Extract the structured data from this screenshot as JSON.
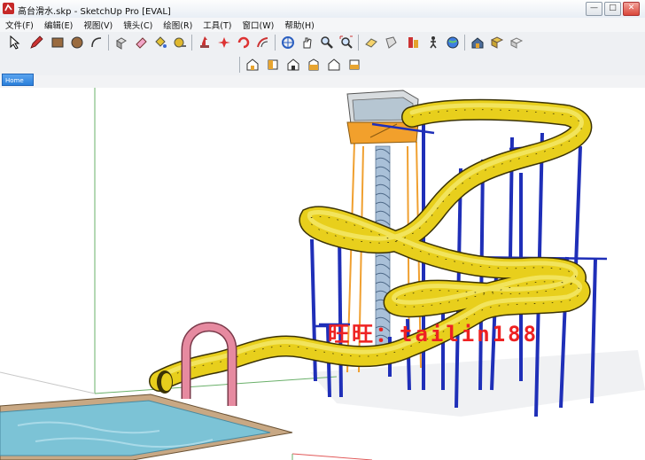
{
  "window": {
    "title": "高台滑水.skp - SketchUp Pro [EVAL]",
    "buttons": {
      "minimize": "—",
      "maximize": "□",
      "close": "✕"
    }
  },
  "menubar": {
    "items": [
      "文件(F)",
      "编辑(E)",
      "视图(V)",
      "镜头(C)",
      "绘图(R)",
      "工具(T)",
      "窗口(W)",
      "帮助(H)"
    ]
  },
  "toolbar": {
    "main_icons": [
      "select-icon",
      "pencil-icon",
      "rectangle-icon",
      "circle-icon",
      "arc-icon",
      "push-pull-icon",
      "eraser-icon",
      "paint-bucket-icon",
      "tape-measure-icon",
      "move-icon",
      "rotate-icon",
      "scale-icon",
      "offset-icon",
      "orbit-icon",
      "pan-icon",
      "zoom-icon",
      "zoom-extents-icon",
      "section-icon",
      "components-icon",
      "materials-icon",
      "walk-icon",
      "geo-icon",
      "warehouse-icon",
      "extension-icon",
      "share-icon"
    ],
    "view_icons": [
      "iso-view-icon",
      "top-view-icon",
      "front-view-icon",
      "right-view-icon",
      "back-view-icon",
      "left-view-icon"
    ]
  },
  "scene_tab": {
    "label": "Home"
  },
  "viewport": {
    "watermark": "旺旺：tailin188",
    "colors": {
      "slide_tube": "#e8cf1c",
      "support_columns": "#1f2fb8",
      "tower_frame": "#f0a030",
      "spiral_stair": "#8fa9c8",
      "entry_arch": "#e68aa0",
      "pool_water": "#7cc3d6",
      "pool_deck": "#c8a884"
    }
  }
}
